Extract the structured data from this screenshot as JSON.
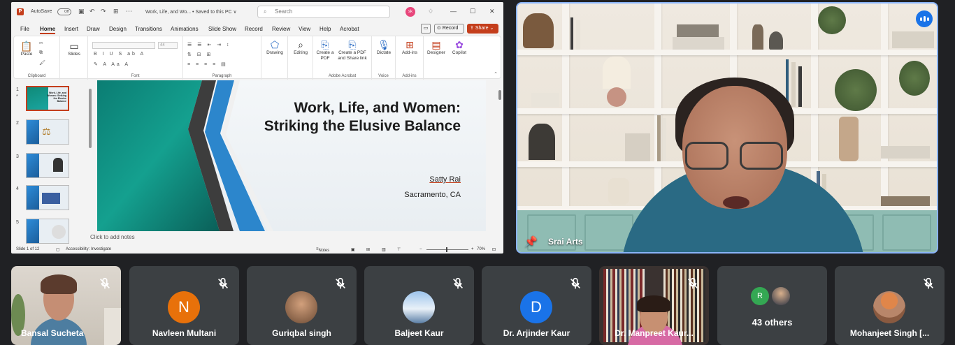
{
  "ppt": {
    "logo_letter": "P",
    "autosave_label": "AutoSave",
    "autosave_state": "Off",
    "doc_title": "Work, Life, and Wo... • Saved to this PC ∨",
    "search_placeholder": "Search",
    "user_initials": "sk",
    "menu_tabs": [
      "File",
      "Home",
      "Insert",
      "Draw",
      "Design",
      "Transitions",
      "Animations",
      "Slide Show",
      "Record",
      "Review",
      "View",
      "Help",
      "Acrobat"
    ],
    "active_tab": "Home",
    "record_label": "Record",
    "share_label": "Share",
    "ribbon": {
      "paste": "Paste",
      "slides": "Slides",
      "clipboard": "Clipboard",
      "font_size": "44",
      "font": "Font",
      "paragraph": "Paragraph",
      "drawing": "Drawing",
      "editing": "Editing",
      "create_pdf": "Create a PDF",
      "create_pdf_share": "Create a PDF and Share link",
      "adobe_acrobat": "Adobe Acrobat",
      "dictate": "Dictate",
      "voice": "Voice",
      "addins": "Add-ins",
      "addins_group": "Add-ins",
      "designer": "Designer",
      "copilot": "Copilot"
    },
    "thumbnails": [
      {
        "num": "1",
        "title": "Work, Life, and Women: Striking the Elusive Balance"
      },
      {
        "num": "2",
        "title": ""
      },
      {
        "num": "3",
        "title": ""
      },
      {
        "num": "4",
        "title": ""
      },
      {
        "num": "5",
        "title": ""
      }
    ],
    "thumb_marker": "*",
    "slide": {
      "title": "Work, Life, and Women: Striking the Elusive Balance",
      "author": "Satty Rai",
      "location": "Sacramento, CA"
    },
    "notes_placeholder": "Click to add notes",
    "status": {
      "slide_counter": "Slide 1 of 12",
      "accessibility": "Accessibility: Investigate",
      "notes": "Notes",
      "zoom": "70%"
    }
  },
  "presenter": {
    "name": "Srai Arts"
  },
  "participants": [
    {
      "name": "Bansal Sucheta",
      "type": "video",
      "muted": true
    },
    {
      "name": "Navleen Multani",
      "type": "initial",
      "initial": "N",
      "color": "#e8710a",
      "muted": true
    },
    {
      "name": "Guriqbal singh",
      "type": "photo",
      "muted": true
    },
    {
      "name": "Baljeet Kaur",
      "type": "photo",
      "muted": true
    },
    {
      "name": "Dr. Arjinder Kaur",
      "type": "initial",
      "initial": "D",
      "color": "#1a73e8",
      "muted": true
    },
    {
      "name": "Dr. Manpreet Kaur...",
      "type": "video",
      "muted": true
    },
    {
      "name": "43 others",
      "type": "others",
      "initial": "R",
      "color": "#34a853",
      "muted": false
    },
    {
      "name": "Mohanjeet Singh [...",
      "type": "photo",
      "muted": true
    }
  ],
  "icons": {
    "mic_off": "mic-off-icon",
    "pin": "pin-icon",
    "speaking": "speaking-indicator-icon"
  },
  "colors": {
    "ppt_accent": "#c43e1c",
    "meet_blue": "#1a73e8",
    "tile_bg": "#3c4043",
    "page_bg": "#202124"
  }
}
